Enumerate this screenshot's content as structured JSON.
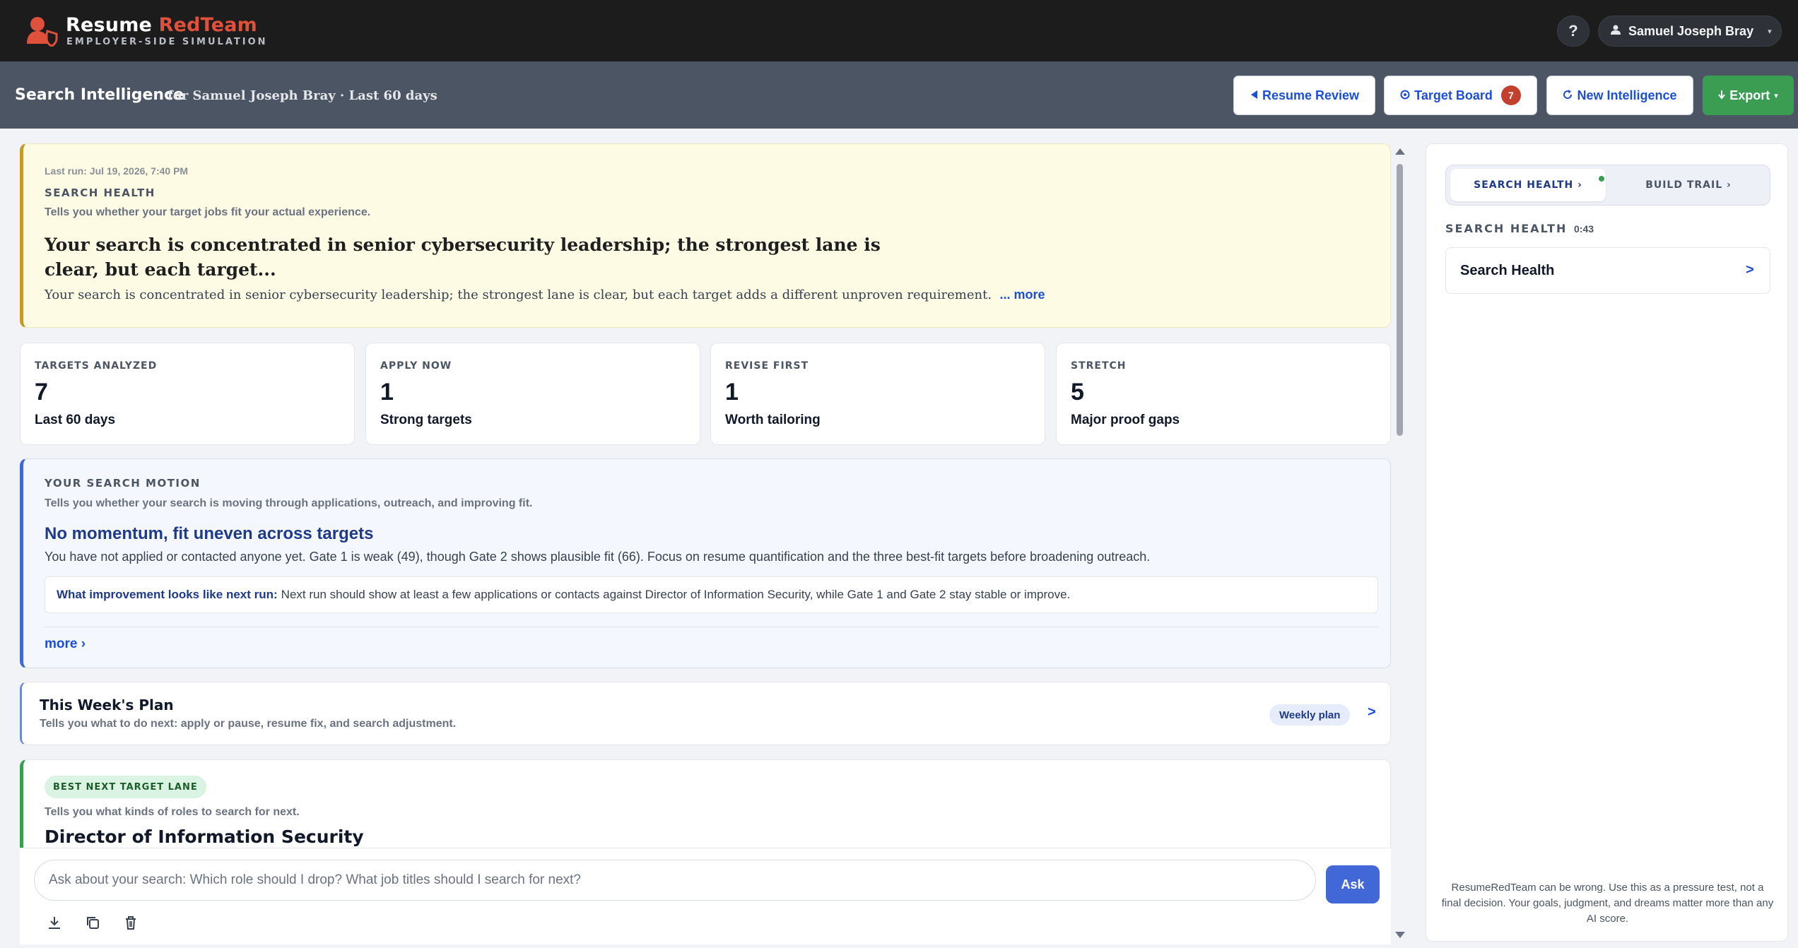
{
  "app": {
    "brand_main": "Resume",
    "brand_accent": "RedTeam",
    "brand_sub": "EMPLOYER-SIDE SIMULATION",
    "help_label": "?",
    "user_name": "Samuel Joseph Bray",
    "user_chevron": "▾"
  },
  "header": {
    "title": "Search Intelligence",
    "subtitle": "for Samuel Joseph Bray · Last 60 days",
    "buttons": {
      "resume_review": "Resume Review",
      "target_board": "Target Board",
      "target_board_count": "7",
      "new_intelligence": "New Intelligence",
      "export": "Export"
    }
  },
  "health": {
    "last_run": "Last run: Jul 19, 2026, 7:40 PM",
    "eyebrow": "SEARCH HEALTH",
    "help": "Tells you whether your target jobs fit your actual experience.",
    "headline": "Your search is concentrated in senior cybersecurity leadership; the strongest lane is clear, but each target...",
    "body": "Your search is concentrated in senior cybersecurity leadership; the strongest lane is clear, but each target adds a different unproven requirement.",
    "more_label": "... more"
  },
  "stats": [
    {
      "label": "TARGETS ANALYZED",
      "value": "7",
      "sub": "Last 60 days"
    },
    {
      "label": "APPLY NOW",
      "value": "1",
      "sub": "Strong targets"
    },
    {
      "label": "REVISE FIRST",
      "value": "1",
      "sub": "Worth tailoring"
    },
    {
      "label": "STRETCH",
      "value": "5",
      "sub": "Major proof gaps"
    }
  ],
  "motion": {
    "eyebrow": "YOUR SEARCH MOTION",
    "help": "Tells you whether your search is moving through applications, outreach, and improving fit.",
    "title": "No momentum, fit uneven across targets",
    "body": "You have not applied or contacted anyone yet. Gate 1 is weak (49), though Gate 2 shows plausible fit (66). Focus on resume quantification and the three best-fit targets before broadening outreach.",
    "box_label": "What improvement looks like next run:",
    "box_text": "Next run should show at least a few applications or contacts against Director of Information Security, while Gate 1 and Gate 2 stay stable or improve.",
    "more_label": "more ›"
  },
  "plan": {
    "title": "This Week's Plan",
    "help": "Tells you what to do next: apply or pause, resume fix, and search adjustment.",
    "pill": "Weekly plan",
    "chevron": ">"
  },
  "lane": {
    "badge": "BEST NEXT TARGET LANE",
    "help": "Tells you what kinds of roles to search for next.",
    "title": "Director of Information Security"
  },
  "chat": {
    "placeholder": "Ask about your search: Which role should I drop? What job titles should I search for next?",
    "ask_label": "Ask"
  },
  "right_panel": {
    "tabs": [
      "SEARCH HEALTH ›",
      "BUILD TRAIL ›"
    ],
    "eyebrow": "SEARCH HEALTH",
    "time": "0:43",
    "item_label": "Search Health",
    "item_chevron": ">",
    "disclaimer": "ResumeRedTeam can be wrong. Use this as a pressure test, not a final decision. Your goals, judgment, and dreams matter more than any AI score."
  },
  "colors": {
    "accent_red": "#e0513b",
    "primary_blue": "#1d4ed8",
    "export_green": "#3a9d52",
    "health_gold": "#c49a2b"
  },
  "icons": [
    "user-shield-logo-icon",
    "user-icon",
    "chevron-down-icon",
    "back-arrow-icon",
    "target-icon",
    "refresh-icon",
    "download-icon",
    "copy-icon",
    "trash-icon"
  ]
}
